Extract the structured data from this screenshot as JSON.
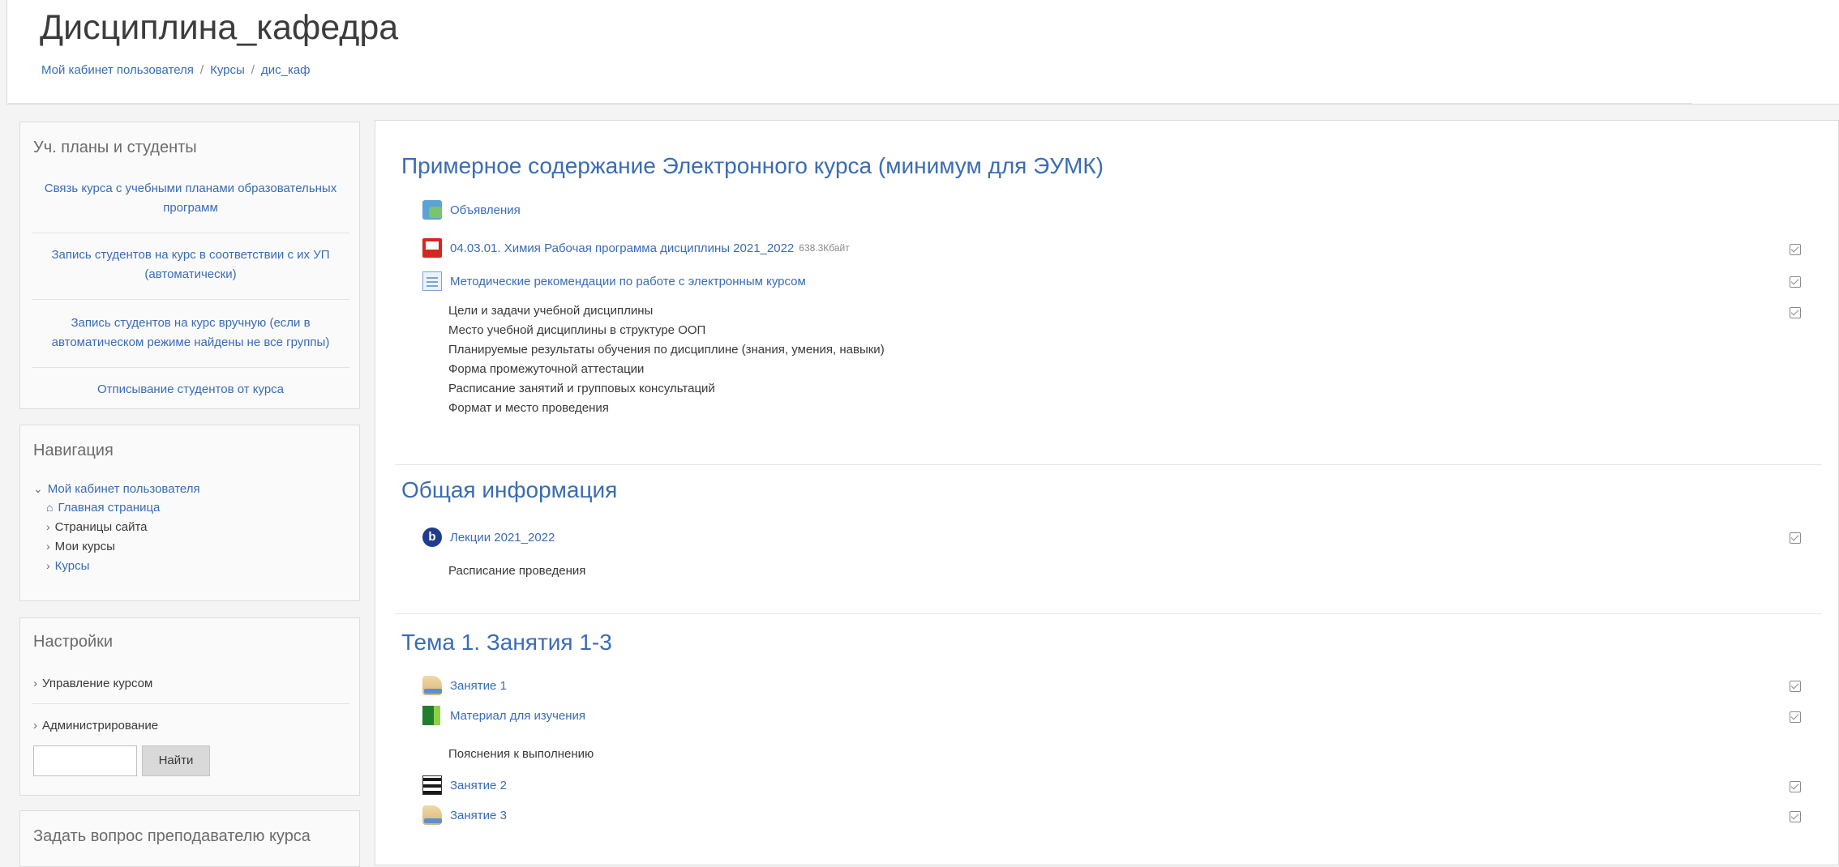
{
  "header": {
    "title": "Дисциплина_кафедра",
    "breadcrumbs": [
      "Мой кабинет пользователя",
      "Курсы",
      "дис_каф"
    ],
    "separator": "/"
  },
  "blocks": {
    "plans": {
      "title": "Уч. планы и студенты",
      "items": [
        {
          "line1": "Связь курса с учебными планами образовательных",
          "line2": "программ"
        },
        {
          "line1": "Запись студентов на курс в соответствии с их УП",
          "line2": "(автоматически)"
        },
        {
          "line1": "Запись студентов на курс вручную (если в",
          "line2": "автоматическом режиме найдены не все группы)"
        },
        {
          "line1": "Отписывание студентов от курса",
          "line2": ""
        }
      ]
    },
    "navigation": {
      "title": "Навигация",
      "root": "Мой кабинет пользователя",
      "home": "Главная страница",
      "items": [
        "Страницы сайта",
        "Мои курсы",
        "Курсы"
      ]
    },
    "settings": {
      "title": "Настройки",
      "items": [
        "Управление курсом",
        "Администрирование"
      ],
      "search_placeholder": "",
      "search_button": "Найти"
    },
    "ask": {
      "title": "Задать вопрос преподавателю курса"
    }
  },
  "sections": [
    {
      "title": "Примерное содержание Электронного курса (минимум для ЭУМК)",
      "activities": [
        {
          "icon": "forum-icon",
          "label": "Объявления",
          "size": ""
        },
        {
          "icon": "pdf-icon",
          "label": "04.03.01. Химия Рабочая программа дисциплины 2021_2022",
          "size": "638.3Кбайт"
        },
        {
          "icon": "page-icon",
          "label": "Методические рекомендации по работе с электронным курсом",
          "size": ""
        }
      ],
      "text_lines": [
        "Цели и задачи учебной дисциплины",
        "Место учебной дисциплины в структуре ООП",
        "Планируемые результаты обучения по дисциплине (знания, умения, навыки)",
        "Форма промежуточной аттестации",
        "Расписание занятий и групповых консультаций",
        "Формат и место проведения"
      ]
    },
    {
      "title": "Общая информация",
      "activities": [
        {
          "icon": "blackboard-icon",
          "label": "Лекции 2021_2022",
          "glyph": "b"
        }
      ],
      "text_lines": [
        "Расписание проведения"
      ]
    },
    {
      "title": "Тема 1. Занятия 1-3",
      "activities": [
        {
          "icon": "lesson-icon",
          "label": "Занятие 1"
        },
        {
          "icon": "book-icon",
          "label": "Материал для изучения"
        },
        {
          "icon": "quiz-icon",
          "label": "Занятие 2"
        },
        {
          "icon": "lesson-icon",
          "label": "Занятие 3"
        }
      ],
      "text_lines": [
        "Пояснения к выполнению"
      ]
    }
  ],
  "colors": {
    "link": "#3a6cb6",
    "text": "#373a3c",
    "background": "#f4f4f4"
  }
}
